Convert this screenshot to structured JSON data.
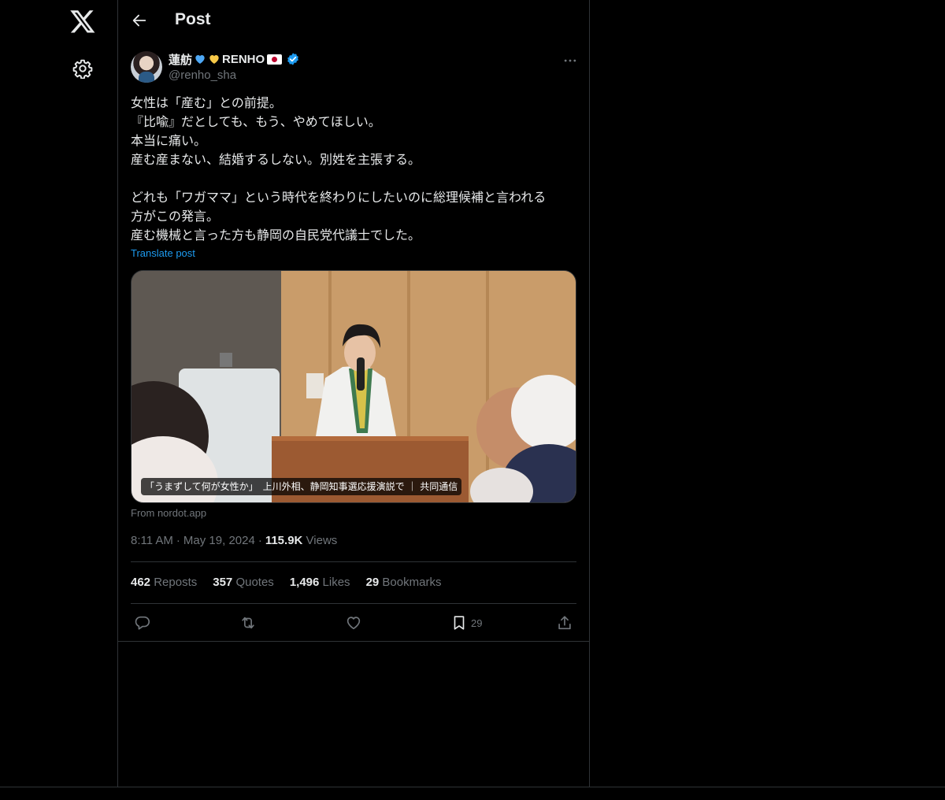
{
  "header": {
    "title": "Post"
  },
  "author": {
    "display_name": "蓮舫",
    "display_suffix": "RENHO",
    "handle": "@renho_sha"
  },
  "post": {
    "lines": [
      "女性は「産む」との前提。",
      "『比喩』だとしても、もう、やめてほしい。",
      "本当に痛い。",
      "産む産まない、結婚するしない。別姓を主張する。",
      "",
      "どれも「ワガママ」という時代を終わりにしたいのに総理候補と言われる",
      "方がこの発言。",
      "産む機械と言った方も静岡の自民党代議士でした。"
    ],
    "translate_label": "Translate post"
  },
  "card": {
    "caption": "「うまずして何が女性か」　上川外相、静岡知事選応援演説で ｜ 共同通信",
    "source": "From nordot.app"
  },
  "meta": {
    "time": "8:11 AM",
    "date": "May 19, 2024",
    "views_count": "115.9K",
    "views_label": "Views"
  },
  "stats": {
    "reposts_count": "462",
    "reposts_label": "Reposts",
    "quotes_count": "357",
    "quotes_label": "Quotes",
    "likes_count": "1,496",
    "likes_label": "Likes",
    "bookmarks_count": "29",
    "bookmarks_label": "Bookmarks"
  },
  "actions": {
    "bookmark_count": "29"
  },
  "icons": {
    "logo": "x-logo-icon",
    "settings": "gear-icon",
    "back": "arrow-left-icon",
    "more": "more-horizontal-icon",
    "reply": "reply-icon",
    "repost": "repost-icon",
    "like": "heart-icon",
    "bookmark": "bookmark-icon",
    "share": "share-icon"
  },
  "colors": {
    "background": "#000000",
    "text": "#e7e9ea",
    "muted": "#71767b",
    "accent": "#1d9bf0",
    "border": "#2f3336"
  }
}
